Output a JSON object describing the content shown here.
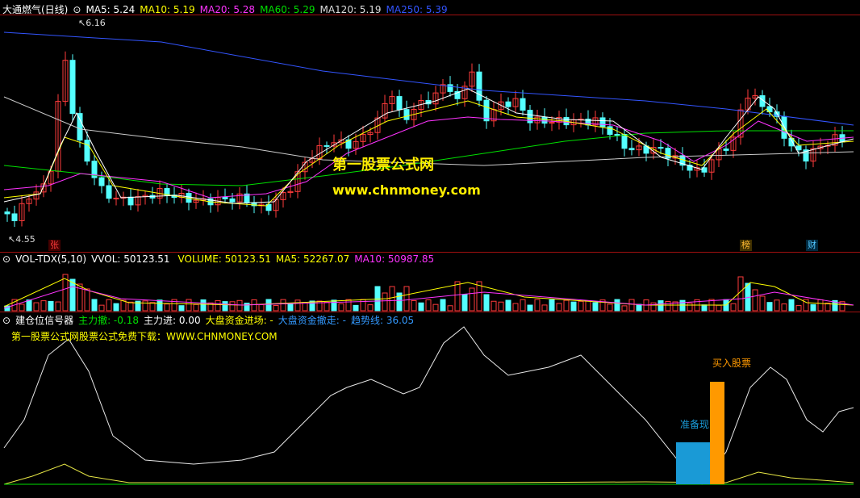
{
  "header": {
    "stock": "大通燃气(日线)",
    "ma5": "MA5: 5.24",
    "ma10": "MA10: 5.19",
    "ma20": "MA20: 5.28",
    "ma60": "MA60: 5.29",
    "ma120": "MA120: 5.19",
    "ma250": "MA250: 5.39"
  },
  "price": {
    "high_label": "6.16",
    "low_label": "4.55"
  },
  "watermark": {
    "line1": "第一股票公式网",
    "line2": "www.chnmoney.com"
  },
  "flags": {
    "zhang": "张",
    "bang": "榜",
    "cai": "财"
  },
  "volume_header": {
    "name": "VOL-TDX(5,10)",
    "vvol": "VVOL: 50123.51",
    "volume": "VOLUME: 50123.51",
    "ma5": "MA5: 52267.07",
    "ma10": "MA10: 50987.85"
  },
  "indicator_header": {
    "name": "建仓位信号器",
    "zl_sell": "主力撤: -0.18",
    "zl_buy": "主力进: 0.00",
    "dapan_in": "大盘资金进场: -",
    "dapan_out": "大盘资金撤走: -",
    "trend": "趋势线: 36.05"
  },
  "indicator_note": "第一股票公式网股票公式免费下载：WWW.CHNMONEY.COM",
  "annotations": {
    "prepare": "准备现",
    "buy": "买入股票"
  },
  "colors": {
    "up": "#ff3b3b",
    "down": "#54ffff",
    "ma5": "#ffffff",
    "ma10": "#ffff00",
    "ma20": "#ff33ff",
    "ma60": "#00e000",
    "ma120": "#cccccc",
    "ma250": "#3355ff",
    "grid": "#a01010",
    "orange": "#ff9900",
    "blue": "#1a9ad6"
  }
}
